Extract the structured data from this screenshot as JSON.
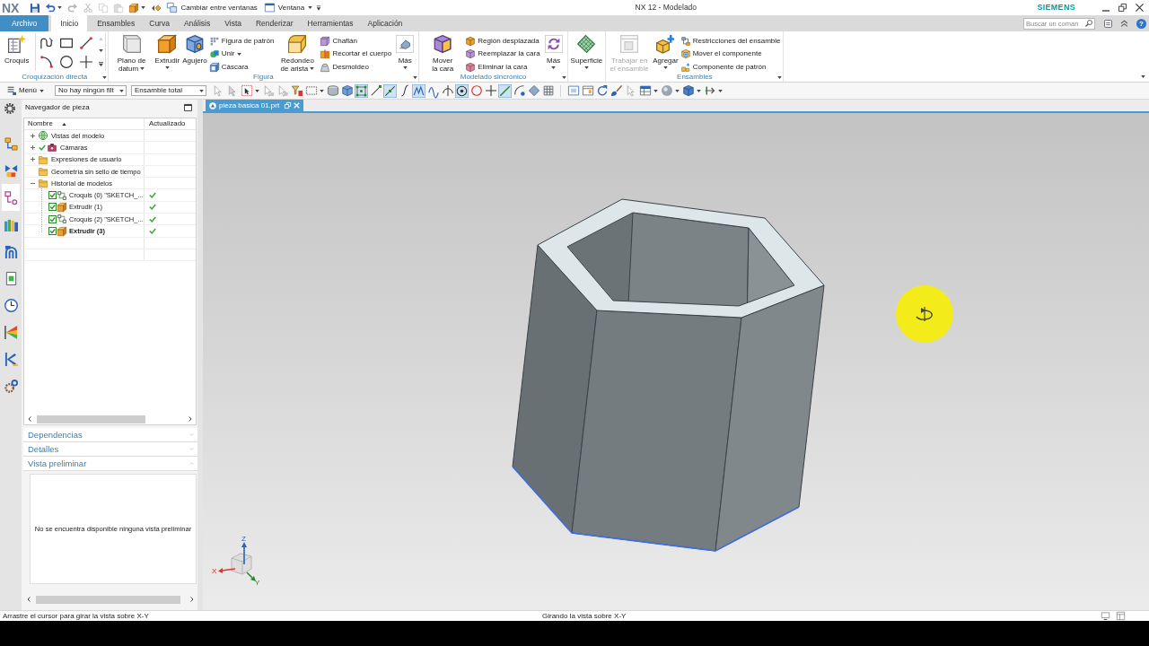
{
  "title_bar": {
    "logo": "NX",
    "switch_windows": "Cambiar entre ventanas",
    "window_menu": "Ventana",
    "title": "NX 12 - Modelado",
    "brand": "SIEMENS"
  },
  "quick_access": [
    {
      "disabled": false,
      "dropdown": false
    },
    {
      "disabled": false,
      "dropdown": true
    },
    {
      "disabled": true,
      "dropdown": false
    },
    {
      "disabled": true,
      "dropdown": false
    },
    {
      "disabled": true,
      "dropdown": false
    },
    {
      "disabled": true,
      "dropdown": false
    },
    {
      "disabled": false,
      "dropdown": true
    },
    {
      "disabled": false,
      "dropdown": false
    }
  ],
  "ribbon_tabs": [
    {
      "label": "Archivo",
      "kind": "file",
      "selected": false
    },
    {
      "label": "Inicio",
      "kind": "tab",
      "selected": true
    },
    {
      "label": "Ensambles",
      "kind": "tab",
      "selected": false
    },
    {
      "label": "Curva",
      "kind": "tab",
      "selected": false
    },
    {
      "label": "Análisis",
      "kind": "tab",
      "selected": false
    },
    {
      "label": "Vista",
      "kind": "tab",
      "selected": false
    },
    {
      "label": "Renderizar",
      "kind": "tab",
      "selected": false
    },
    {
      "label": "Herramientas",
      "kind": "tab",
      "selected": false
    },
    {
      "label": "Aplicación",
      "kind": "tab",
      "selected": false
    }
  ],
  "command_search": {
    "placeholder": "Buscar un coman"
  },
  "help_button": "?",
  "ribbon_groups": [
    {
      "label": "Croquización directa",
      "items": [
        {
          "kind": "large",
          "label": "Croquis",
          "dropdown": false,
          "disabled": false
        },
        {
          "kind": "gallery"
        }
      ]
    },
    {
      "label": "Figura",
      "items": [
        {
          "kind": "large",
          "label": "Plano de datum",
          "dropdown": true,
          "disabled": false
        },
        {
          "kind": "large",
          "label": "Extrudir",
          "dropdown": true,
          "disabled": false
        },
        {
          "kind": "large",
          "label": "Agujero",
          "dropdown": false,
          "disabled": false
        },
        {
          "kind": "stack",
          "entries": [
            {
              "label": "Figura de patrón",
              "dropdown": false
            },
            {
              "label": "Unir",
              "dropdown": true
            },
            {
              "label": "Cáscara",
              "dropdown": false
            }
          ]
        },
        {
          "kind": "large",
          "label": "Redondeo de arista",
          "dropdown": true,
          "disabled": false
        },
        {
          "kind": "stack",
          "entries": [
            {
              "label": "Chaflán",
              "dropdown": false
            },
            {
              "label": "Recortar el cuerpo",
              "dropdown": false
            },
            {
              "label": "Desmoldeo",
              "dropdown": false
            }
          ]
        },
        {
          "kind": "more",
          "label": "Más",
          "dropdown": true,
          "disabled": false
        }
      ]
    },
    {
      "label": "Modelado sincrónico",
      "items": [
        {
          "kind": "large",
          "label": "Mover la cara",
          "dropdown": false,
          "disabled": false
        },
        {
          "kind": "stack",
          "entries": [
            {
              "label": "Región desplazada",
              "dropdown": false
            },
            {
              "label": "Reemplazar la cara",
              "dropdown": false
            },
            {
              "label": "Eliminar la cara",
              "dropdown": false
            }
          ]
        },
        {
          "kind": "more",
          "label": "Más",
          "dropdown": true,
          "disabled": false
        }
      ]
    },
    {
      "items": [
        {
          "kind": "large",
          "label": "Superficie",
          "dropdown": true,
          "disabled": false
        }
      ]
    },
    {
      "label": "Ensambles",
      "items": [
        {
          "kind": "large",
          "label": "Trabajar en el ensamble",
          "dropdown": false,
          "disabled": true
        },
        {
          "kind": "large",
          "label": "Agregar",
          "dropdown": true,
          "disabled": false
        },
        {
          "kind": "stack",
          "entries": [
            {
              "label": "Restricciones del ensamble",
              "dropdown": false
            },
            {
              "label": "Mover el componente",
              "dropdown": false
            },
            {
              "label": "Componente de patrón",
              "dropdown": false
            }
          ]
        }
      ]
    }
  ],
  "view_toolbar": {
    "menu": "Menú",
    "selection_filter": "No hay ningún filt",
    "scope": "Ensamble total",
    "tools": [
      {
        "on": false,
        "disabled": true,
        "dropdown": false
      },
      {
        "on": false,
        "disabled": true,
        "dropdown": false
      },
      {
        "on": false,
        "disabled": false,
        "dropdown": true
      },
      {
        "on": false,
        "disabled": true,
        "dropdown": false
      },
      {
        "on": false,
        "disabled": true,
        "dropdown": false
      },
      {
        "on": false,
        "disabled": false,
        "dropdown": false
      },
      {
        "on": false,
        "disabled": false,
        "dropdown": true
      },
      {
        "on": false,
        "disabled": false,
        "dropdown": false
      },
      {
        "on": false,
        "disabled": false,
        "dropdown": false
      },
      {
        "on": true,
        "disabled": false,
        "dropdown": false
      },
      {
        "on": false,
        "disabled": false,
        "dropdown": false
      },
      {
        "on": true,
        "disabled": false,
        "dropdown": false
      },
      {
        "on": false,
        "disabled": false,
        "dropdown": false
      },
      {
        "on": true,
        "disabled": false,
        "dropdown": false
      },
      {
        "on": false,
        "disabled": false,
        "dropdown": false
      },
      {
        "on": false,
        "disabled": false,
        "dropdown": false
      },
      {
        "on": true,
        "disabled": false,
        "dropdown": false
      },
      {
        "on": false,
        "disabled": false,
        "dropdown": false
      },
      {
        "on": false,
        "disabled": false,
        "dropdown": false
      },
      {
        "on": true,
        "disabled": false,
        "dropdown": false
      },
      {
        "on": false,
        "disabled": false,
        "dropdown": false
      },
      {
        "on": false,
        "disabled": false,
        "dropdown": false
      },
      {
        "on": false,
        "disabled": false,
        "dropdown": false
      },
      {
        "on": false,
        "disabled": false,
        "dropdown": false
      },
      {
        "on": false,
        "disabled": false,
        "dropdown": false
      },
      {
        "on": false,
        "disabled": false,
        "dropdown": false
      },
      {
        "on": false,
        "disabled": false,
        "dropdown": false
      },
      {
        "on": false,
        "disabled": true,
        "dropdown": false
      },
      {
        "on": false,
        "disabled": false,
        "dropdown": true
      },
      {
        "on": false,
        "disabled": false,
        "dropdown": true
      },
      {
        "on": false,
        "disabled": false,
        "dropdown": true
      },
      {
        "on": false,
        "disabled": false,
        "dropdown": true
      }
    ]
  },
  "resource_bar": [
    {
      "selected": false
    },
    {
      "selected": false
    },
    {
      "selected": true
    },
    {
      "selected": false
    },
    {
      "selected": false
    },
    {
      "selected": false
    },
    {
      "selected": false
    },
    {
      "selected": false
    },
    {
      "selected": false
    },
    {
      "selected": false
    }
  ],
  "part_navigator": {
    "title": "Navegador de pieza",
    "columns": [
      "Nombre",
      "Actualizado"
    ],
    "nodes": [
      {
        "label": "Vistas del modelo",
        "expanded": false
      },
      {
        "label": "Cámaras",
        "expanded": false
      },
      {
        "label": "Expresiones de usuario",
        "expanded": false
      },
      {
        "label": "Geometría sin sello de tiempo"
      },
      {
        "label": "Historial de modelos",
        "expanded": true,
        "children": [
          {
            "label": "Croquis (0) \"SKETCH_...",
            "checked": true,
            "updated": true,
            "current": false
          },
          {
            "label": "Extrudir (1)",
            "checked": true,
            "updated": true,
            "current": false
          },
          {
            "label": "Croquis (2) \"SKETCH_...",
            "checked": true,
            "updated": true,
            "current": false
          },
          {
            "label": "Extrudir (3)",
            "checked": true,
            "updated": true,
            "current": true
          }
        ]
      }
    ]
  },
  "panels": [
    {
      "title": "Dependencias",
      "expanded": false
    },
    {
      "title": "Detalles",
      "expanded": false
    },
    {
      "title": "Vista preliminar",
      "expanded": true,
      "message": "No se encuentra disponible ninguna vista preliminar"
    }
  ],
  "graphics_window": {
    "tab": {
      "label": "pieza basica 01.prt",
      "selected": true
    },
    "triad": [
      "X",
      "Y",
      "Z"
    ]
  },
  "status_bar": {
    "prompt": "Arrastre el cursor para girar la vista sobre X-Y",
    "status": "Girando la vista sobre X-Y"
  }
}
